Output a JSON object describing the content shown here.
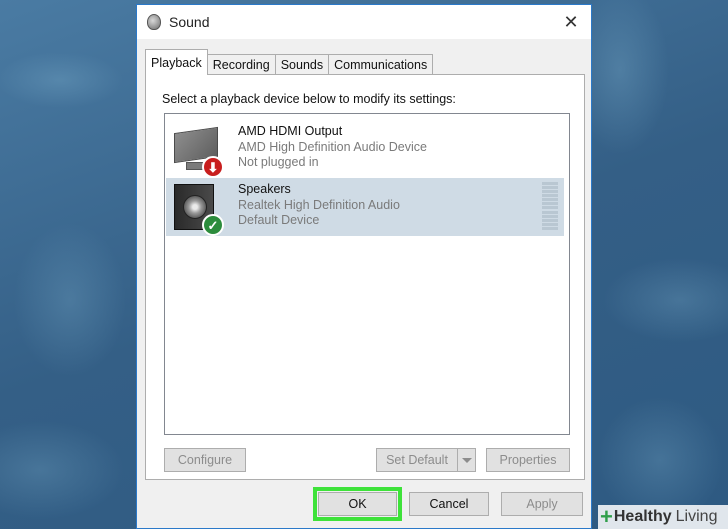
{
  "window": {
    "title": "Sound",
    "close_glyph": "✕"
  },
  "tabs": [
    {
      "label": "Playback",
      "active": true
    },
    {
      "label": "Recording",
      "active": false
    },
    {
      "label": "Sounds",
      "active": false
    },
    {
      "label": "Communications",
      "active": false
    }
  ],
  "instruction": "Select a playback device below to modify its settings:",
  "devices": [
    {
      "name": "AMD HDMI Output",
      "description": "AMD High Definition Audio Device",
      "status": "Not plugged in",
      "icon": "monitor-icon",
      "badge": "red-down-arrow-icon",
      "badge_glyph": "⬇",
      "selected": false
    },
    {
      "name": "Speakers",
      "description": "Realtek High Definition Audio",
      "status": "Default Device",
      "icon": "speaker-icon",
      "badge": "green-check-icon",
      "badge_glyph": "✓",
      "selected": true
    }
  ],
  "buttons": {
    "configure": "Configure",
    "set_default": "Set Default",
    "properties": "Properties",
    "ok": "OK",
    "cancel": "Cancel",
    "apply": "Apply"
  },
  "watermark": {
    "brand": "Healthy",
    "suffix": "Living"
  },
  "colors": {
    "selected_row": "#cfdbe5",
    "highlight": "#3ee23a",
    "title_border": "#2b79c9"
  }
}
